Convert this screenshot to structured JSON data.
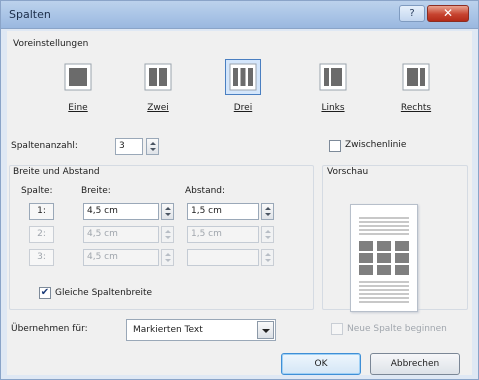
{
  "window": {
    "title": "Spalten",
    "help_glyph": "?",
    "close_glyph": "✕"
  },
  "presets": {
    "label": "Voreinstellungen",
    "items": [
      {
        "key": "eine",
        "label": "Eine",
        "selected": false
      },
      {
        "key": "zwei",
        "label": "Zwei",
        "selected": false
      },
      {
        "key": "drei",
        "label": "Drei",
        "selected": true
      },
      {
        "key": "links",
        "label": "Links",
        "selected": false
      },
      {
        "key": "rechts",
        "label": "Rechts",
        "selected": false
      }
    ]
  },
  "column_count": {
    "label": "Spaltenanzahl:",
    "value": "3"
  },
  "separator": {
    "label": "Zwischenlinie",
    "checked": false
  },
  "width_spacing": {
    "label": "Breite und Abstand",
    "col_header": "Spalte:",
    "width_header": "Breite:",
    "spacing_header": "Abstand:",
    "rows": [
      {
        "num": "1:",
        "width": "4,5 cm",
        "spacing": "1,5 cm",
        "enabled": true
      },
      {
        "num": "2:",
        "width": "4,5 cm",
        "spacing": "1,5 cm",
        "enabled": false
      },
      {
        "num": "3:",
        "width": "4,5 cm",
        "spacing": "",
        "enabled": false
      }
    ]
  },
  "equal_width": {
    "label": "Gleiche Spaltenbreite",
    "checked": true,
    "check_glyph": "✔"
  },
  "preview": {
    "label": "Vorschau"
  },
  "apply_to": {
    "label": "Übernehmen für:",
    "value": "Markierten Text"
  },
  "new_column": {
    "label": "Neue Spalte beginnen",
    "checked": false
  },
  "buttons": {
    "ok": "OK",
    "cancel": "Abbrechen"
  },
  "colors": {
    "accent": "#4a7fc1",
    "preview_block": "#7f7f7f",
    "preview_lines": "#c8c8c8"
  }
}
